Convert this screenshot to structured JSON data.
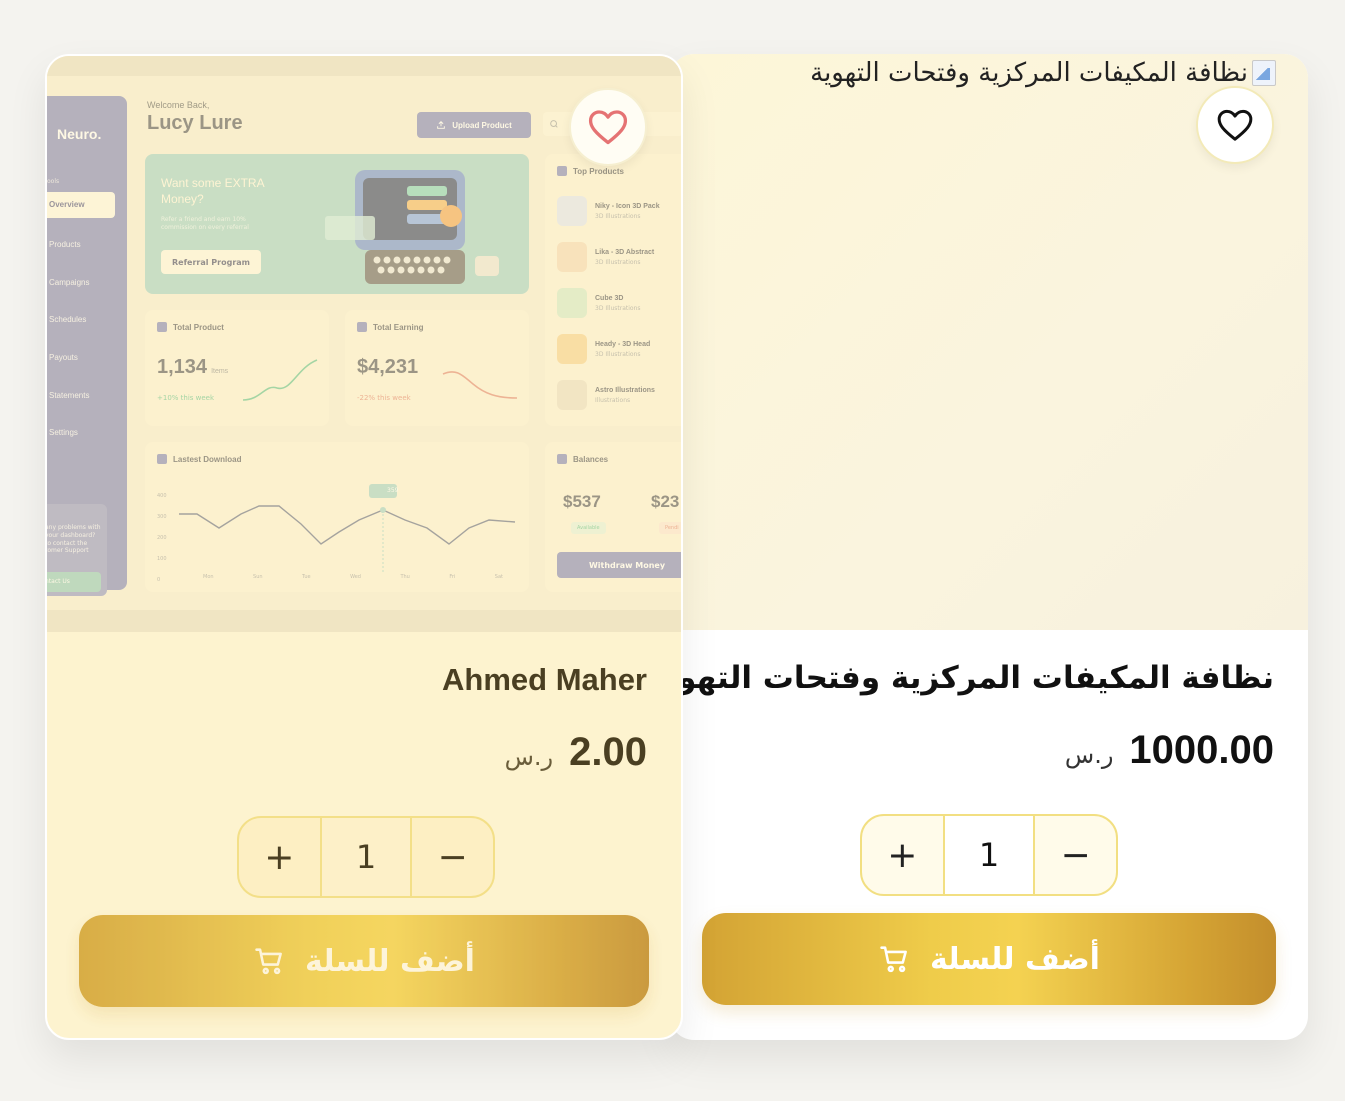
{
  "cards": [
    {
      "side": "right",
      "image_alt": "نظافة المكيفات المركزية وفتحات التهوية",
      "title": "نظافة المكيفات المركزية وفتحات التهوية",
      "price": "1000.00",
      "currency": "ر.س",
      "quantity": "1",
      "plus": "+",
      "minus": "−",
      "add_to_cart": "أضف للسلة",
      "favorited": false
    },
    {
      "side": "left",
      "title": "Ahmed Maher",
      "price": "2.00",
      "currency": "ر.س",
      "quantity": "1",
      "plus": "+",
      "minus": "−",
      "add_to_cart": "أضف للسلة",
      "favorited": false,
      "preview": {
        "logo": "Neuro.",
        "tools_label": "ools",
        "nav": [
          "Overview",
          "Products",
          "Campaigns",
          "Schedules",
          "Payouts",
          "Statements",
          "Settings"
        ],
        "help_text": "any problems with your dashboard? to contact the tomer Support",
        "contact_label": "ntact Us",
        "welcome": "Welcome Back,",
        "user": "Lucy Lure",
        "upload": "Upload Product",
        "banner_title": "Want some EXTRA Money?",
        "banner_sub": "Refer a friend and earn 10% commission on every referral",
        "banner_btn": "Referral Program",
        "total_product_title": "Total Product",
        "total_product_value": "1,134",
        "total_product_unit": "Items",
        "total_product_change": "+10% this week",
        "total_earning_title": "Total Earning",
        "total_earning_value": "$4,231",
        "total_earning_change": "-22% this week",
        "top_products_title": "Top Products",
        "top_products": [
          {
            "name": "Niky - Icon 3D Pack",
            "sub": "3D Illustrations"
          },
          {
            "name": "Lika - 3D Abstract",
            "sub": "3D Illustrations"
          },
          {
            "name": "Cube 3D",
            "sub": "3D Illustrations"
          },
          {
            "name": "Heady - 3D Head",
            "sub": "3D Illustrations"
          },
          {
            "name": "Astro Illustrations",
            "sub": "Illustrations"
          }
        ],
        "download_title": "Lastest Download",
        "download_y_ticks": [
          "400",
          "300",
          "200",
          "100",
          "0"
        ],
        "download_days": [
          "Mon",
          "Sun",
          "Tue",
          "Wed",
          "Thu",
          "Fri",
          "Sat"
        ],
        "download_tooltip": "359",
        "balances_title": "Balances",
        "balance_1": "$537",
        "balance_1_tag": "Available",
        "balance_2": "$23",
        "balance_2_tag": "Pendi",
        "withdraw": "Withdraw Money"
      }
    }
  ],
  "colors": {
    "accent_gold": "#efcc4a",
    "heart_active": "#e57373",
    "dashboard_primary": "#7b7fb6"
  }
}
